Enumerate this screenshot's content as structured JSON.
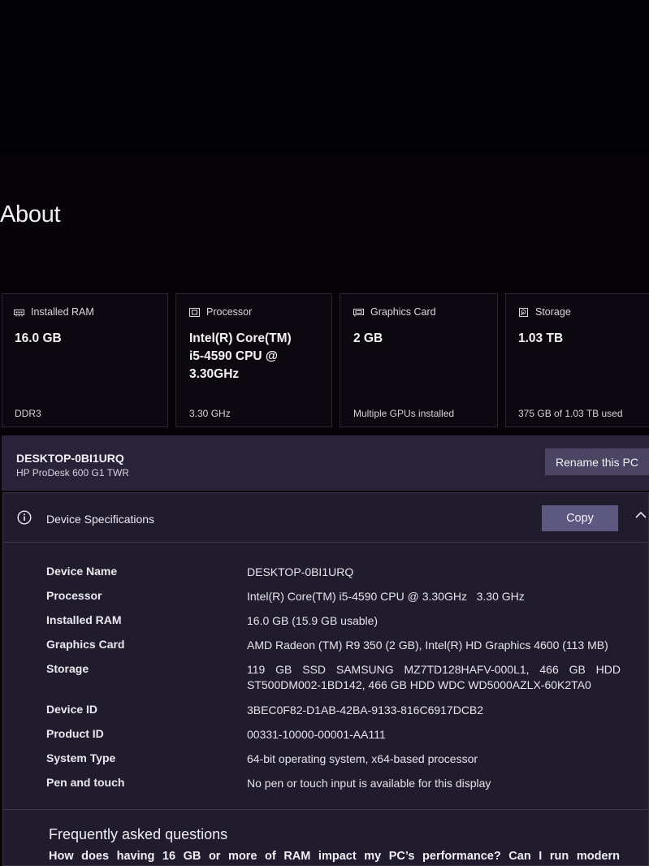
{
  "page": {
    "title": "About"
  },
  "cards": [
    {
      "icon": "ram-icon",
      "label": "Installed RAM",
      "value": "16.0 GB",
      "sub": "DDR3"
    },
    {
      "icon": "processor-icon",
      "label": "Processor",
      "value_lines": [
        "Intel(R) Core(TM)",
        "i5-4590 CPU @",
        "3.30GHz"
      ],
      "sub": "3.30 GHz"
    },
    {
      "icon": "graphics-card-icon",
      "label": "Graphics Card",
      "value": "2 GB",
      "sub": "Multiple GPUs installed"
    },
    {
      "icon": "storage-icon",
      "label": "Storage",
      "value": "1.03 TB",
      "sub": "375 GB of 1.03 TB used"
    }
  ],
  "device": {
    "name": "DESKTOP-0BI1URQ",
    "model": "HP ProDesk 600 G1 TWR",
    "rename_label": "Rename this PC"
  },
  "specs": {
    "title": "Device Specifications",
    "copy_label": "Copy",
    "rows": [
      {
        "label": "Device Name",
        "value": "DESKTOP-0BI1URQ"
      },
      {
        "label": "Processor",
        "value": "Intel(R) Core(TM) i5-4590 CPU @ 3.30GHz   3.30 GHz"
      },
      {
        "label": "Installed RAM",
        "value": "16.0 GB (15.9 GB usable)"
      },
      {
        "label": "Graphics Card",
        "value": "AMD Radeon (TM) R9 350 (2 GB), Intel(R) HD Graphics 4600 (113 MB)"
      },
      {
        "label": "Storage",
        "value": "119 GB SSD SAMSUNG MZ7TD128HAFV-000L1, 466 GB HDD ST500DM002-1BD142, 466 GB HDD WDC WD5000AZLX-60K2TA0"
      },
      {
        "label": "Device ID",
        "value": "3BEC0F82-D1AB-42BA-9133-816C6917DCB2"
      },
      {
        "label": "Product ID",
        "value": "00331-10000-00001-AA111"
      },
      {
        "label": "System Type",
        "value": "64-bit operating system, x64-based processor"
      },
      {
        "label": "Pen and touch",
        "value": "No pen or touch input is available for this display"
      }
    ]
  },
  "faq": {
    "title": "Frequently asked questions",
    "question": "How does having 16 GB or more of RAM impact my PC’s performance? Can I run modern"
  },
  "colors": {
    "background": "#070409",
    "card_background": "#0c0810",
    "name_bar": "#29233a",
    "panel": "#211c2d",
    "rename_button": "#4b4563",
    "copy_button": "#5d5880"
  }
}
